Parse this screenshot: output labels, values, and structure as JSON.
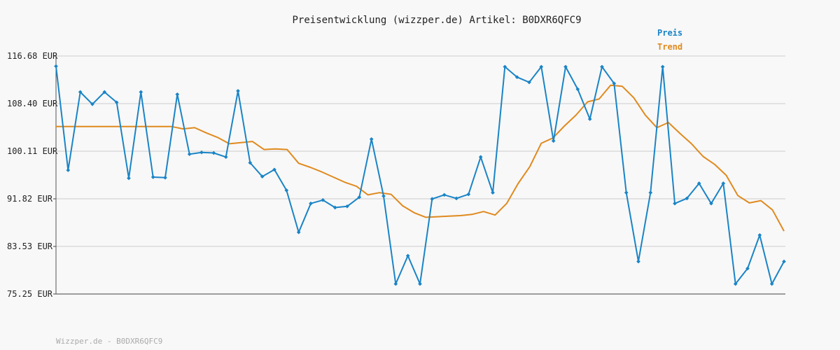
{
  "chart_data": {
    "type": "line",
    "title": "Preisentwicklung (wizzper.de) Artikel: B0DXR6QFC9",
    "footer": "Wizzper.de - B0DXR6QFC9",
    "y_unit": "EUR",
    "ylim": [
      75.25,
      116.68
    ],
    "y_ticks": [
      "116.68 EUR",
      "108.40 EUR",
      "100.11 EUR",
      "91.82 EUR",
      "83.53 EUR",
      "75.25 EUR"
    ],
    "y_tick_values": [
      116.68,
      108.4,
      100.11,
      91.82,
      83.53,
      75.25
    ],
    "grid": true,
    "legend_placement": "top-right",
    "series": [
      {
        "name": "Preis",
        "color": "#1a84c6",
        "markers": true,
        "values": [
          114.9,
          96.8,
          110.4,
          108.3,
          110.4,
          108.6,
          95.4,
          110.4,
          95.6,
          95.5,
          110.0,
          99.6,
          99.9,
          99.8,
          99.1,
          110.6,
          98.1,
          95.7,
          96.9,
          93.3,
          86.0,
          91.0,
          91.6,
          90.3,
          90.5,
          92.1,
          102.2,
          92.3,
          77.0,
          81.9,
          77.0,
          91.8,
          92.5,
          91.9,
          92.6,
          99.1,
          92.9,
          114.8,
          113.0,
          112.1,
          114.8,
          101.9,
          114.8,
          110.9,
          105.7,
          114.8,
          111.9,
          92.9,
          80.9,
          92.9,
          114.8,
          91.0,
          91.9,
          94.5,
          91.0,
          94.5,
          77.0,
          79.7,
          85.5,
          77.0,
          80.9
        ]
      },
      {
        "name": "Trend",
        "color": "#e08a1e",
        "markers": false,
        "values": [
          104.4,
          104.4,
          104.4,
          104.4,
          104.4,
          104.4,
          104.4,
          104.4,
          104.4,
          104.4,
          104.4,
          104.0,
          104.2,
          103.3,
          102.5,
          101.4,
          101.6,
          101.8,
          100.4,
          100.5,
          100.4,
          98.0,
          97.3,
          96.5,
          95.6,
          94.7,
          94.0,
          92.5,
          92.9,
          92.6,
          90.6,
          89.4,
          88.6,
          88.7,
          88.8,
          88.9,
          89.1,
          89.6,
          89.0,
          91.0,
          94.5,
          97.4,
          101.5,
          102.4,
          104.5,
          106.4,
          108.7,
          109.2,
          111.6,
          111.4,
          109.4,
          106.4,
          104.2,
          105.1,
          103.2,
          101.4,
          99.2,
          97.8,
          95.9,
          92.4,
          91.1,
          91.5,
          89.9,
          86.2
        ]
      }
    ]
  }
}
